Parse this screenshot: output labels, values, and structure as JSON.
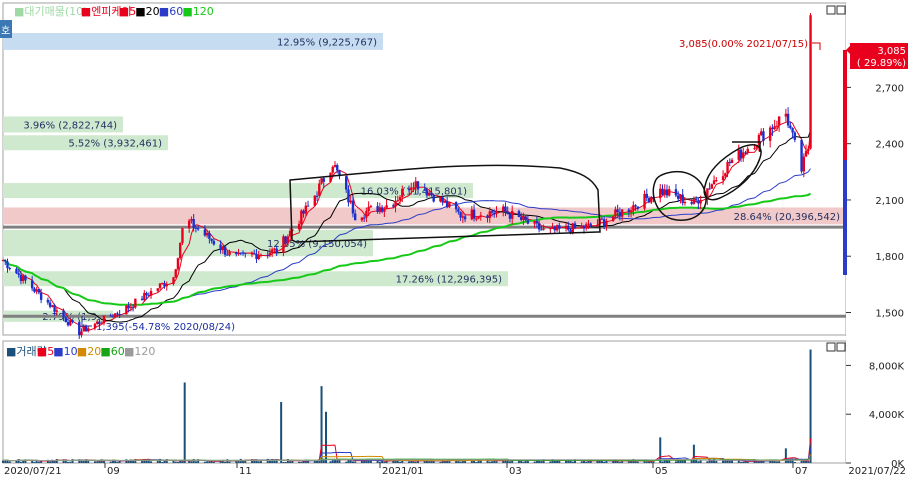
{
  "price_panel": {
    "legend": [
      {
        "text": "■대기매물(10)",
        "color": "#9fd9a6"
      },
      {
        "text": "■엔피케이",
        "color": "#e8001c"
      },
      {
        "text": "■5",
        "color": "#e8001c"
      },
      {
        "text": "■20",
        "color": "#000000"
      },
      {
        "text": "■60",
        "color": "#2a3cc8"
      },
      {
        "text": "■120",
        "color": "#17c917"
      }
    ],
    "y_ticks": [
      "2,700",
      "2,400",
      "2,100",
      "1,800",
      "1,500"
    ],
    "last_price_label": "3,085",
    "last_change_label": "( 29.89%)",
    "high_annotation": "3,085(0.00% 2021/07/15)",
    "low_annotation": "1,395(-54.78% 2020/08/24)",
    "side_tab_label": "호"
  },
  "volume_panel": {
    "legend": [
      {
        "text": "■거래량",
        "color": "#1a4f7a"
      },
      {
        "text": "■5",
        "color": "#e8001c"
      },
      {
        "text": "■10",
        "color": "#2a3cc8"
      },
      {
        "text": "■20",
        "color": "#d48a00"
      },
      {
        "text": "■60",
        "color": "#17a517"
      },
      {
        "text": "■120",
        "color": "#9a9a9a"
      }
    ],
    "y_ticks": [
      "8,000K",
      "4,000K",
      "0K"
    ]
  },
  "x_axis": {
    "start_label": "2020/07/21",
    "labels": [
      "09",
      "11",
      "2021/01",
      "03",
      "05",
      "07"
    ],
    "end_label": "2021/07/22"
  },
  "chart_data": {
    "type": "candlestick",
    "x_range": [
      "2020/07/21",
      "2021/07/22"
    ],
    "price_ylim": [
      1380,
      3150
    ],
    "volume_ylim": [
      0,
      10000
    ],
    "volume_unit": "K",
    "moving_averages": [
      5,
      20,
      60,
      120
    ],
    "overhead_supply_bands": [
      {
        "label": "12.95% (9,225,767)",
        "low": 2900,
        "high": 2990,
        "color": "#c6dcf0"
      },
      {
        "label": "3.96% (2,822,744)",
        "low": 2460,
        "high": 2545,
        "color": "#cfe9cf"
      },
      {
        "label": "5.52% (3,932,461)",
        "low": 2365,
        "high": 2445,
        "color": "#cfe9cf"
      },
      {
        "label": "16.03% (11,415,801)",
        "low": 2110,
        "high": 2190,
        "color": "#cfe9cf"
      },
      {
        "label": "28.64% (20,396,542)",
        "low": 1970,
        "high": 2060,
        "color": "#f2c9c9"
      },
      {
        "label": "12.85% (9,150,054)",
        "low": 1800,
        "high": 1940,
        "color": "#cfe9cf"
      },
      {
        "label": "17.26% (12,296,395)",
        "low": 1640,
        "high": 1720,
        "color": "#cfe9cf"
      },
      {
        "label": "2.79% (1,9…",
        "low": 1450,
        "high": 1510,
        "color": "#cfe9cf"
      }
    ],
    "horizontal_lines": [
      1955,
      1480
    ],
    "anchors": [
      {
        "date": "2020/07/21",
        "price": 1780
      },
      {
        "date": "2020/08/24",
        "price": 1395
      },
      {
        "date": "2020/09/15",
        "price": 1530
      },
      {
        "date": "2020/10/05",
        "price": 1690
      },
      {
        "date": "2020/10/10",
        "price": 2000
      },
      {
        "date": "2020/11/01",
        "price": 1790
      },
      {
        "date": "2020/11/20",
        "price": 1830
      },
      {
        "date": "2020/12/05",
        "price": 2080
      },
      {
        "date": "2020/12/15",
        "price": 2300
      },
      {
        "date": "2020/12/25",
        "price": 2020
      },
      {
        "date": "2021/01/10",
        "price": 2080
      },
      {
        "date": "2021/01/20",
        "price": 2200
      },
      {
        "date": "2021/02/10",
        "price": 2020
      },
      {
        "date": "2021/03/01",
        "price": 2040
      },
      {
        "date": "2021/03/20",
        "price": 1930
      },
      {
        "date": "2021/04/10",
        "price": 1960
      },
      {
        "date": "2021/04/25",
        "price": 2050
      },
      {
        "date": "2021/05/10",
        "price": 2150
      },
      {
        "date": "2021/05/25",
        "price": 2080
      },
      {
        "date": "2021/06/10",
        "price": 2300
      },
      {
        "date": "2021/06/25",
        "price": 2450
      },
      {
        "date": "2021/07/05",
        "price": 2560
      },
      {
        "date": "2021/07/12",
        "price": 2260
      },
      {
        "date": "2021/07/15",
        "price": 2380
      },
      {
        "date": "2021/07/16",
        "price": 3085
      }
    ],
    "volume_spikes": [
      {
        "date": "2020/10/10",
        "value": 6600
      },
      {
        "date": "2020/11/22",
        "value": 5000
      },
      {
        "date": "2020/12/10",
        "value": 6300
      },
      {
        "date": "2020/12/12",
        "value": 4200
      },
      {
        "date": "2021/05/10",
        "value": 2100
      },
      {
        "date": "2021/05/25",
        "value": 1500
      },
      {
        "date": "2021/07/05",
        "value": 1200
      },
      {
        "date": "2021/07/16",
        "value": 9300
      }
    ]
  }
}
